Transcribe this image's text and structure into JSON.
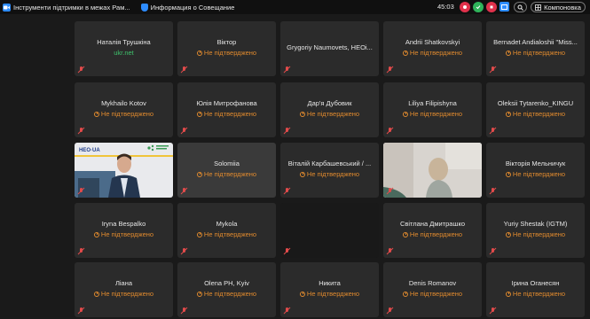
{
  "topbar": {
    "tab1_title": "Інструменти підтримки в межах Рам...",
    "tab2_title": "Информация о Совещание",
    "time": "45:03",
    "layout_label": "Компоновка"
  },
  "colors": {
    "tile_bg": "#2b2b2b",
    "status_pending": "#e08a2e",
    "status_domain": "#3ec16b",
    "accent": "#2d8cff"
  },
  "tiles": [
    {
      "name": "Наталія Трушкіна",
      "status": "ukr.net"
    },
    {
      "name": "Віктор",
      "status": "Не підтверджено"
    },
    {
      "name": "Grygoriy Naumovets, HEOi...",
      "status": ""
    },
    {
      "name": "Andrii Shatkovskyi",
      "status": "Не підтверджено"
    },
    {
      "name": "Bernadet Andialoshii \"Miss...",
      "status": "Не підтверджено"
    },
    {
      "name": "Mykhailo Kotov",
      "status": "Не підтверджено"
    },
    {
      "name": "Юлія Митрофанова",
      "status": "Не підтверджено"
    },
    {
      "name": "Дар'я Дубовик",
      "status": "Не підтверджено"
    },
    {
      "name": "Liliya Filipishyna",
      "status": "Не підтверджено"
    },
    {
      "name": "Oleksii Tytarenko_KINGU",
      "status": "Не підтверджено"
    },
    {
      "name": "",
      "status": "",
      "video": "HEO·UA"
    },
    {
      "name": "Solomiia",
      "status": "Не підтверджено"
    },
    {
      "name": "Віталій Карбашевський / ...",
      "status": "Не підтверджено"
    },
    {
      "name": "",
      "status": ""
    },
    {
      "name": "Вікторія Мельничук",
      "status": "Не підтверджено"
    },
    {
      "name": "Iryna Bespalko",
      "status": "Не підтверджено"
    },
    {
      "name": "Mykola",
      "status": "Не підтверджено"
    },
    {
      "name": "",
      "status": ""
    },
    {
      "name": "Світлана Дмитрашко",
      "status": "Не підтверджено"
    },
    {
      "name": "Yuriy Shestak (IGTM)",
      "status": "Не підтверджено"
    },
    {
      "name": "Ліана",
      "status": "Не підтверджено"
    },
    {
      "name": "Olena PH, Kyiv",
      "status": "Не підтверджено"
    },
    {
      "name": "Никита",
      "status": "Не підтверджено"
    },
    {
      "name": "Denis Romanov",
      "status": "Не підтверджено"
    },
    {
      "name": "Ірина Оганесян",
      "status": "Не підтверджено"
    }
  ]
}
